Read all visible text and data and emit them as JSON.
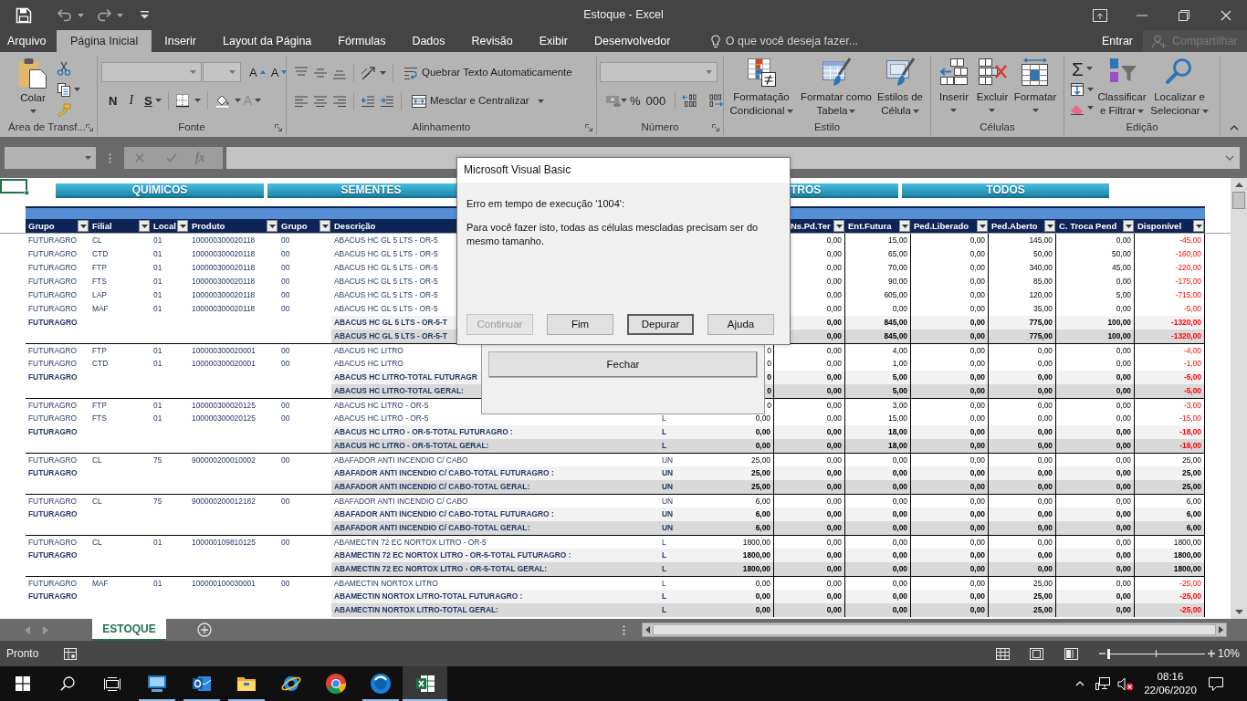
{
  "title_bar": {
    "title": "Estoque - Excel"
  },
  "ribbon_tabs": [
    {
      "label": "Arquivo",
      "selected": false
    },
    {
      "label": "Página Inicial",
      "selected": true
    },
    {
      "label": "Inserir",
      "selected": false
    },
    {
      "label": "Layout da Página",
      "selected": false
    },
    {
      "label": "Fórmulas",
      "selected": false
    },
    {
      "label": "Dados",
      "selected": false
    },
    {
      "label": "Revisão",
      "selected": false
    },
    {
      "label": "Exibir",
      "selected": false
    },
    {
      "label": "Desenvolvedor",
      "selected": false
    }
  ],
  "tell_me": {
    "placeholder": "O que você deseja fazer..."
  },
  "account": {
    "sign_in": "Entrar",
    "share": {
      "label": "Compartilhar",
      "disabled": true
    }
  },
  "ribbon": {
    "groups": [
      {
        "kind": "clipboard",
        "label": "Área de Transf...",
        "paste": "Colar"
      },
      {
        "kind": "font",
        "label": "Fonte",
        "grow": "A",
        "shrink": "A",
        "bold": "N",
        "italic": "I",
        "underline": "S",
        "font_color": "A"
      },
      {
        "kind": "alignment",
        "label": "Alinhamento",
        "wrap": "Quebrar Texto Automaticamente",
        "merge": "Mesclar e Centralizar"
      },
      {
        "kind": "number",
        "label": "Número",
        "percent": "%",
        "thousands": "000"
      },
      {
        "kind": "styles",
        "label": "Estilo",
        "buttons": [
          {
            "lines": [
              "Formatação",
              "Condicional"
            ]
          },
          {
            "lines": [
              "Formatar como",
              "Tabela"
            ]
          },
          {
            "lines": [
              "Estilos de",
              "Célula"
            ]
          }
        ]
      },
      {
        "kind": "cells",
        "label": "Células",
        "buttons": [
          {
            "label": "Inserir"
          },
          {
            "label": "Excluir"
          },
          {
            "label": "Formatar"
          }
        ]
      },
      {
        "kind": "editing",
        "label": "Edição",
        "autosum": "Σ",
        "buttons": [
          {
            "lines": [
              "Classificar",
              "e Filtrar"
            ]
          },
          {
            "lines": [
              "Localizar e",
              "Selecionar"
            ]
          }
        ]
      }
    ]
  },
  "formula_bar": {
    "function_label": "fx"
  },
  "sheet": {
    "buttons": [
      "QUÍMICOS",
      "SEMENTES",
      "TROS",
      "TODOS"
    ],
    "columns": [
      "Grupo",
      "Filial",
      "Local",
      "Produto",
      "Grupo",
      "Descrição",
      null,
      null,
      "Ns.Pd.Ter",
      "Ent.Futura",
      "Ped.Liberado",
      "Ped.Aberto",
      "C. Troca Pend",
      "Disponível"
    ],
    "rows": [
      {
        "kind": "detail",
        "negative": true,
        "cells": [
          "FUTURAGRO",
          "CL",
          "01",
          "100000300020118",
          "00",
          "ABACUS HC GL 5 LTS - OR-5",
          null,
          null,
          "0,00",
          "15,00",
          "0,00",
          "145,00",
          "0,00",
          "-45,00"
        ]
      },
      {
        "kind": "detail",
        "negative": true,
        "cells": [
          "FUTURAGRO",
          "CTD",
          "01",
          "100000300020118",
          "00",
          "ABACUS HC GL 5 LTS - OR-5",
          null,
          null,
          "0,00",
          "65,00",
          "0,00",
          "50,00",
          "50,00",
          "-160,00"
        ]
      },
      {
        "kind": "detail",
        "negative": true,
        "cells": [
          "FUTURAGRO",
          "FTP",
          "01",
          "100000300020118",
          "00",
          "ABACUS HC GL 5 LTS - OR-5",
          null,
          null,
          "0,00",
          "70,00",
          "0,00",
          "340,00",
          "45,00",
          "-220,00"
        ]
      },
      {
        "kind": "detail",
        "negative": true,
        "cells": [
          "FUTURAGRO",
          "FTS",
          "01",
          "100000300020118",
          "00",
          "ABACUS HC GL 5 LTS - OR-5",
          null,
          null,
          "0,00",
          "90,00",
          "0,00",
          "85,00",
          "0,00",
          "-175,00"
        ]
      },
      {
        "kind": "detail",
        "negative": true,
        "cells": [
          "FUTURAGRO",
          "LAP",
          "01",
          "100000300020118",
          "00",
          "ABACUS HC GL 5 LTS - OR-5",
          null,
          null,
          "0,00",
          "605,00",
          "0,00",
          "120,00",
          "5,00",
          "-715,00"
        ]
      },
      {
        "kind": "detail",
        "negative": true,
        "cells": [
          "FUTURAGRO",
          "MAF",
          "01",
          "100000300020118",
          "00",
          "ABACUS HC GL 5 LTS - OR-5",
          null,
          null,
          "0,00",
          "0,00",
          "0,00",
          "35,00",
          "0,00",
          "-5,00"
        ]
      },
      {
        "kind": "subtotal",
        "negative": true,
        "cells": [
          "FUTURAGRO",
          null,
          null,
          null,
          null,
          "ABACUS HC GL 5 LTS - OR-5-T",
          null,
          null,
          "0,00",
          "845,00",
          "0,00",
          "775,00",
          "100,00",
          "-1320,00"
        ]
      },
      {
        "kind": "total",
        "negative": true,
        "cells": [
          null,
          null,
          null,
          null,
          null,
          "ABACUS HC GL 5 LTS - OR-5-T",
          null,
          null,
          "0,00",
          "845,00",
          "0,00",
          "775,00",
          "100,00",
          "-1320,00"
        ]
      },
      {
        "kind": "detail",
        "negative": true,
        "cells": [
          "FUTURAGRO",
          "FTP",
          "01",
          "100000300020001",
          "00",
          "ABACUS HC LITRO",
          null,
          "0",
          "0,00",
          "4,00",
          "0,00",
          "0,00",
          "0,00",
          "-4,00"
        ]
      },
      {
        "kind": "detail",
        "negative": true,
        "cells": [
          "FUTURAGRO",
          "CTD",
          "01",
          "100000300020001",
          "00",
          "ABACUS HC LITRO",
          null,
          "0",
          "0,00",
          "1,00",
          "0,00",
          "0,00",
          "0,00",
          "-1,00"
        ]
      },
      {
        "kind": "subtotal",
        "negative": true,
        "cells": [
          "FUTURAGRO",
          null,
          null,
          null,
          null,
          "ABACUS HC LITRO-TOTAL FUTURAGR",
          null,
          "0",
          "0,00",
          "5,00",
          "0,00",
          "0,00",
          "0,00",
          "-5,00"
        ]
      },
      {
        "kind": "total",
        "negative": true,
        "cells": [
          null,
          null,
          null,
          null,
          null,
          "ABACUS HC LITRO-TOTAL GERAL:",
          null,
          "0",
          "0,00",
          "5,00",
          "0,00",
          "0,00",
          "0,00",
          "-5,00"
        ]
      },
      {
        "kind": "detail",
        "negative": true,
        "cells": [
          "FUTURAGRO",
          "FTP",
          "01",
          "100000300020125",
          "00",
          "ABACUS HC LITRO - OR-5",
          null,
          "0",
          "0,00",
          "3,00",
          "0,00",
          "0,00",
          "0,00",
          "-3,00"
        ]
      },
      {
        "kind": "detail",
        "negative": true,
        "cells": [
          "FUTURAGRO",
          "FTS",
          "01",
          "100000300020125",
          "00",
          "ABACUS HC LITRO - OR-5",
          "L",
          "0,00",
          "0,00",
          "15,00",
          "0,00",
          "0,00",
          "0,00",
          "-15,00"
        ]
      },
      {
        "kind": "subtotal",
        "negative": true,
        "cells": [
          "FUTURAGRO",
          null,
          null,
          null,
          null,
          "ABACUS HC LITRO - OR-5-TOTAL FUTURAGRO :",
          "L",
          "0,00",
          "0,00",
          "18,00",
          "0,00",
          "0,00",
          "0,00",
          "-18,00"
        ]
      },
      {
        "kind": "total",
        "negative": true,
        "cells": [
          null,
          null,
          null,
          null,
          null,
          "ABACUS HC LITRO - OR-5-TOTAL GERAL:",
          "L",
          "0,00",
          "0,00",
          "18,00",
          "0,00",
          "0,00",
          "0,00",
          "-18,00"
        ]
      },
      {
        "kind": "detail",
        "negative": false,
        "cells": [
          "FUTURAGRO",
          "CL",
          "75",
          "900000200010002",
          "00",
          "ABAFADOR ANTI INCENDIO C/ CABO",
          "UN",
          "25,00",
          "0,00",
          "0,00",
          "0,00",
          "0,00",
          "0,00",
          "25,00"
        ]
      },
      {
        "kind": "subtotal",
        "negative": false,
        "cells": [
          "FUTURAGRO",
          null,
          null,
          null,
          null,
          "ABAFADOR ANTI INCENDIO C/ CABO-TOTAL FUTURAGRO :",
          "UN",
          "25,00",
          "0,00",
          "0,00",
          "0,00",
          "0,00",
          "0,00",
          "25,00"
        ]
      },
      {
        "kind": "total",
        "negative": false,
        "cells": [
          null,
          null,
          null,
          null,
          null,
          "ABAFADOR ANTI INCENDIO C/ CABO-TOTAL GERAL:",
          "UN",
          "25,00",
          "0,00",
          "0,00",
          "0,00",
          "0,00",
          "0,00",
          "25,00"
        ]
      },
      {
        "kind": "detail",
        "negative": false,
        "cells": [
          "FUTURAGRO",
          "CL",
          "75",
          "900000200012182",
          "00",
          "ABAFADOR ANTI INCENDIO C/ CABO",
          "UN",
          "6,00",
          "0,00",
          "0,00",
          "0,00",
          "0,00",
          "0,00",
          "6,00"
        ]
      },
      {
        "kind": "subtotal",
        "negative": false,
        "cells": [
          "FUTURAGRO",
          null,
          null,
          null,
          null,
          "ABAFADOR ANTI INCENDIO C/ CABO-TOTAL FUTURAGRO :",
          "UN",
          "6,00",
          "0,00",
          "0,00",
          "0,00",
          "0,00",
          "0,00",
          "6,00"
        ]
      },
      {
        "kind": "total",
        "negative": false,
        "cells": [
          null,
          null,
          null,
          null,
          null,
          "ABAFADOR ANTI INCENDIO C/ CABO-TOTAL GERAL:",
          "UN",
          "6,00",
          "0,00",
          "0,00",
          "0,00",
          "0,00",
          "0,00",
          "6,00"
        ]
      },
      {
        "kind": "detail",
        "negative": false,
        "cells": [
          "FUTURAGRO",
          "CL",
          "01",
          "100000109810125",
          "00",
          "ABAMECTIN 72 EC NORTOX LITRO - OR-5",
          "L",
          "1800,00",
          "0,00",
          "0,00",
          "0,00",
          "0,00",
          "0,00",
          "1800,00"
        ]
      },
      {
        "kind": "subtotal",
        "negative": false,
        "cells": [
          "FUTURAGRO",
          null,
          null,
          null,
          null,
          "ABAMECTIN 72 EC NORTOX LITRO - OR-5-TOTAL FUTURAGRO :",
          "L",
          "1800,00",
          "0,00",
          "0,00",
          "0,00",
          "0,00",
          "0,00",
          "1800,00"
        ]
      },
      {
        "kind": "total",
        "negative": false,
        "cells": [
          null,
          null,
          null,
          null,
          null,
          "ABAMECTIN 72 EC NORTOX LITRO - OR-5-TOTAL GERAL:",
          "L",
          "1800,00",
          "0,00",
          "0,00",
          "0,00",
          "0,00",
          "0,00",
          "1800,00"
        ]
      },
      {
        "kind": "detail",
        "negative": true,
        "cells": [
          "FUTURAGRO",
          "MAF",
          "01",
          "100000100030001",
          "00",
          "ABAMECTIN NORTOX LITRO",
          "L",
          "0,00",
          "0,00",
          "0,00",
          "0,00",
          "25,00",
          "0,00",
          "-25,00"
        ]
      },
      {
        "kind": "subtotal",
        "negative": true,
        "cells": [
          "FUTURAGRO",
          null,
          null,
          null,
          null,
          "ABAMECTIN NORTOX LITRO-TOTAL FUTURAGRO :",
          "L",
          "0,00",
          "0,00",
          "0,00",
          "0,00",
          "25,00",
          "0,00",
          "-25,00"
        ]
      },
      {
        "kind": "total",
        "negative": true,
        "cells": [
          null,
          null,
          null,
          null,
          null,
          "ABAMECTIN NORTOX LITRO-TOTAL GERAL:",
          "L",
          "0,00",
          "0,00",
          "0,00",
          "0,00",
          "25,00",
          "0,00",
          "-25,00"
        ]
      }
    ]
  },
  "sheet_tabs": [
    {
      "label": "ESTOQUE",
      "selected": true
    }
  ],
  "status_bar": {
    "status": "Pronto",
    "zoom": "10%",
    "zoom_slider": {
      "level": 0
    }
  },
  "dialog": {
    "title": "Microsoft Visual Basic",
    "heading": "Erro em tempo de execução '1004':",
    "message": "Para você fazer isto, todas as células mescladas precisam ser do mesmo tamanho.",
    "buttons": [
      {
        "label": "Continuar",
        "disabled": true,
        "focused": false
      },
      {
        "label": "Fim",
        "disabled": false,
        "focused": false
      },
      {
        "label": "Depurar",
        "disabled": false,
        "focused": true
      },
      {
        "label": "Ajuda",
        "disabled": false,
        "focused": false
      }
    ]
  },
  "user_form": {
    "button": "Fechar"
  },
  "taskbar": {
    "apps": [
      {
        "kind": "screen",
        "running": true,
        "selected": false
      },
      {
        "kind": "mail",
        "running": true,
        "selected": false
      },
      {
        "kind": "folder",
        "running": true,
        "selected": false
      },
      {
        "kind": "orbit",
        "running": false,
        "selected": false
      },
      {
        "kind": "wheel",
        "running": false,
        "selected": false
      },
      {
        "kind": "disc",
        "running": true,
        "selected": false
      },
      {
        "kind": "spreadsheet",
        "running": true,
        "selected": true
      }
    ],
    "tray": {
      "volume_muted": true,
      "time": "08:16",
      "date": "22/06/2020"
    }
  }
}
